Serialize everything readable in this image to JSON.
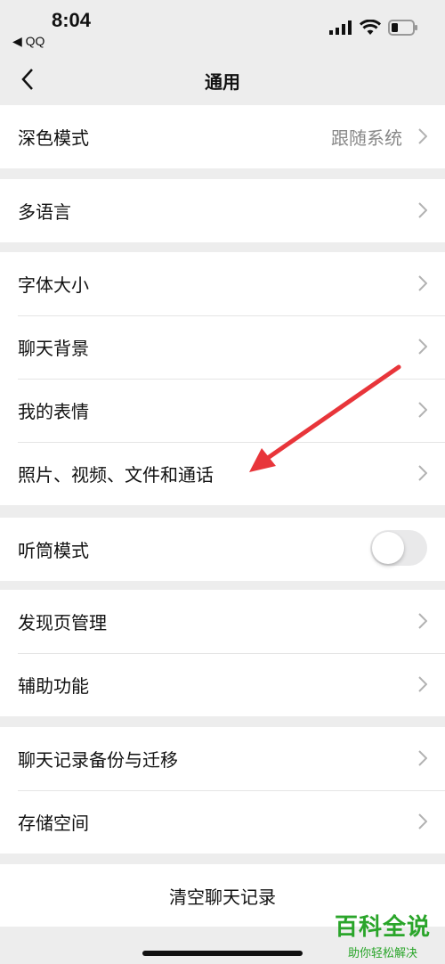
{
  "status_bar": {
    "time": "8:04",
    "back_app": "◀ QQ"
  },
  "nav": {
    "title": "通用"
  },
  "groups": {
    "g1": {
      "dark_mode": {
        "label": "深色模式",
        "value": "跟随系统"
      }
    },
    "g2": {
      "language": {
        "label": "多语言"
      }
    },
    "g3": {
      "font_size": {
        "label": "字体大小"
      },
      "chat_bg": {
        "label": "聊天背景"
      },
      "stickers": {
        "label": "我的表情"
      },
      "media": {
        "label": "照片、视频、文件和通话"
      }
    },
    "g4": {
      "earpiece": {
        "label": "听筒模式",
        "enabled": false
      }
    },
    "g5": {
      "discover": {
        "label": "发现页管理"
      },
      "accessibility": {
        "label": "辅助功能"
      }
    },
    "g6": {
      "backup": {
        "label": "聊天记录备份与迁移"
      },
      "storage": {
        "label": "存储空间"
      }
    }
  },
  "clear_chat": {
    "label": "清空聊天记录"
  },
  "watermark": {
    "title": "百科全说",
    "subtitle": "助你轻松解决"
  },
  "colors": {
    "background": "#ededed",
    "watermark": "#2aa52a",
    "arrow": "#e8353a"
  }
}
